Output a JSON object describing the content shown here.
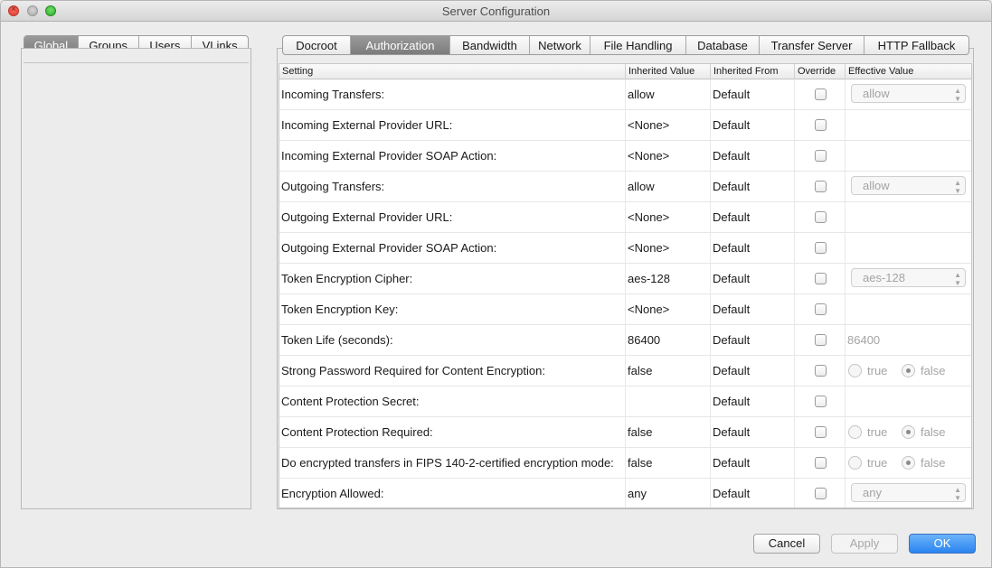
{
  "window": {
    "title": "Server Configuration"
  },
  "left_tabs": [
    {
      "label": "Global",
      "active": true
    },
    {
      "label": "Groups",
      "active": false
    },
    {
      "label": "Users",
      "active": false
    },
    {
      "label": "VLinks",
      "active": false
    }
  ],
  "right_tabs": [
    {
      "label": "Docroot",
      "active": false
    },
    {
      "label": "Authorization",
      "active": true
    },
    {
      "label": "Bandwidth",
      "active": false
    },
    {
      "label": "Network",
      "active": false
    },
    {
      "label": "File Handling",
      "active": false
    },
    {
      "label": "Database",
      "active": false
    },
    {
      "label": "Transfer Server",
      "active": false
    },
    {
      "label": "HTTP Fallback",
      "active": false
    }
  ],
  "table": {
    "headers": [
      "Setting",
      "Inherited Value",
      "Inherited From",
      "Override",
      "Effective Value"
    ],
    "rows": [
      {
        "setting": "Incoming Transfers:",
        "inherited": "allow",
        "from": "Default",
        "override": false,
        "effective_type": "popup",
        "effective": "allow"
      },
      {
        "setting": "Incoming External Provider URL:",
        "inherited": "<None>",
        "from": "Default",
        "override": false,
        "effective_type": "none",
        "effective": ""
      },
      {
        "setting": "Incoming External Provider SOAP Action:",
        "inherited": "<None>",
        "from": "Default",
        "override": false,
        "effective_type": "none",
        "effective": ""
      },
      {
        "setting": "Outgoing Transfers:",
        "inherited": "allow",
        "from": "Default",
        "override": false,
        "effective_type": "popup",
        "effective": "allow"
      },
      {
        "setting": "Outgoing External Provider URL:",
        "inherited": "<None>",
        "from": "Default",
        "override": false,
        "effective_type": "none",
        "effective": ""
      },
      {
        "setting": "Outgoing External Provider SOAP Action:",
        "inherited": "<None>",
        "from": "Default",
        "override": false,
        "effective_type": "none",
        "effective": ""
      },
      {
        "setting": "Token Encryption Cipher:",
        "inherited": "aes-128",
        "from": "Default",
        "override": false,
        "effective_type": "popup",
        "effective": "aes-128"
      },
      {
        "setting": "Token Encryption Key:",
        "inherited": "<None>",
        "from": "Default",
        "override": false,
        "effective_type": "none",
        "effective": ""
      },
      {
        "setting": "Token Life (seconds):",
        "inherited": "86400",
        "from": "Default",
        "override": false,
        "effective_type": "text",
        "effective": "86400"
      },
      {
        "setting": "Strong Password Required for Content Encryption:",
        "inherited": "false",
        "from": "Default",
        "override": false,
        "effective_type": "radio",
        "effective": "false"
      },
      {
        "setting": "Content Protection Secret:",
        "inherited": "",
        "from": "Default",
        "override": false,
        "effective_type": "none",
        "effective": ""
      },
      {
        "setting": "Content Protection Required:",
        "inherited": "false",
        "from": "Default",
        "override": false,
        "effective_type": "radio",
        "effective": "false"
      },
      {
        "setting": "Do encrypted transfers in FIPS 140-2-certified encryption mode:",
        "inherited": "false",
        "from": "Default",
        "override": false,
        "effective_type": "radio",
        "effective": "false"
      },
      {
        "setting": "Encryption Allowed:",
        "inherited": "any",
        "from": "Default",
        "override": false,
        "effective_type": "popup",
        "effective": "any"
      }
    ],
    "radio_labels": {
      "true": "true",
      "false": "false"
    }
  },
  "buttons": {
    "cancel": "Cancel",
    "apply": "Apply",
    "ok": "OK"
  },
  "colors": {
    "accent": "#2a84f0",
    "selected_tab": "#8a8a8a",
    "disabled_text": "#a4a4a4"
  }
}
